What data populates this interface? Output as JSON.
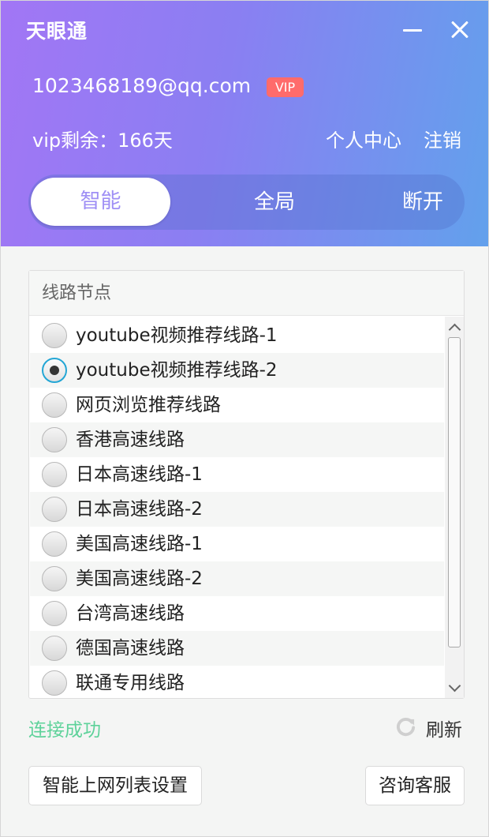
{
  "app": {
    "title": "天眼通"
  },
  "account": {
    "email": "1023468189@qq.com",
    "badge": "VIP",
    "remaining": "vip剩余：166天",
    "profile_link": "个人中心",
    "logout_link": "注销"
  },
  "modes": {
    "smart": "智能",
    "global": "全局",
    "disconnect": "断开",
    "selected": "智能"
  },
  "routes": {
    "title": "线路节点",
    "selected_index": 1,
    "items": [
      {
        "label": "youtube视频推荐线路-1"
      },
      {
        "label": "youtube视频推荐线路-2"
      },
      {
        "label": "网页浏览推荐线路"
      },
      {
        "label": "香港高速线路"
      },
      {
        "label": "日本高速线路-1"
      },
      {
        "label": "日本高速线路-2"
      },
      {
        "label": "美国高速线路-1"
      },
      {
        "label": "美国高速线路-2"
      },
      {
        "label": "台湾高速线路"
      },
      {
        "label": "德国高速线路"
      },
      {
        "label": "联通专用线路"
      }
    ]
  },
  "status": {
    "text": "连接成功",
    "refresh_label": "刷新"
  },
  "footer": {
    "settings_button": "智能上网列表设置",
    "support_button": "咨询客服"
  },
  "colors": {
    "header_start": "#a276f5",
    "header_end": "#62a1ec",
    "accent": "#9f8ff5",
    "vip_badge": "#ff6b6b",
    "status_success": "#5ed29a",
    "radio_checked_ring": "#23a6d5"
  },
  "icons": {
    "minimize": "minimize-icon",
    "close": "close-icon",
    "refresh": "refresh-icon",
    "scroll_up": "chevron-up-icon",
    "scroll_down": "chevron-down-icon"
  }
}
